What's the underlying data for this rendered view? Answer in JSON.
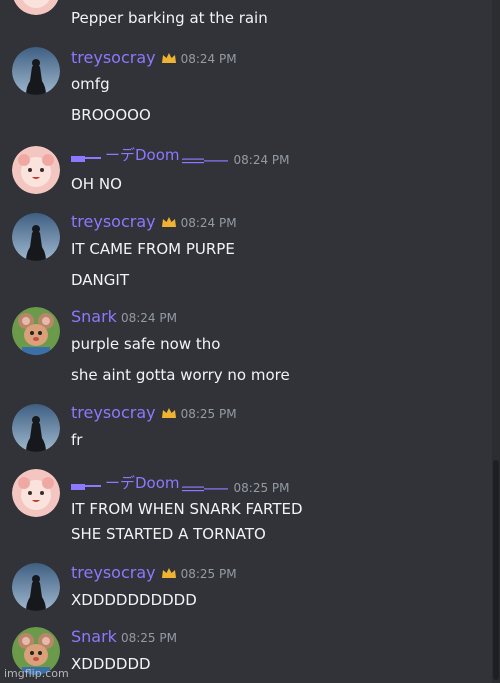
{
  "colors": {
    "background": "#313338",
    "text": "#f2f3f5",
    "timestamp": "#949ba4",
    "treysocray": "#8b79ff",
    "snark": "#8b79ff",
    "doom": "#8b79ff",
    "crown": "#f0b232"
  },
  "messages": [
    {
      "id": "m0",
      "author": "",
      "avatar": "pink-face-avatar",
      "lines": [
        "Pepper barking at the rain"
      ]
    },
    {
      "id": "m1",
      "author": "treysocray",
      "owner_crown": true,
      "avatar": "silhouette-avatar",
      "time": "08:24 PM",
      "lines": [
        "omfg",
        "BROOOOO"
      ]
    },
    {
      "id": "m2",
      "author": "ーデDoom",
      "owner_crown": false,
      "avatar": "pink-face-avatar",
      "time": "08:24 PM",
      "lines": [
        "OH NO"
      ]
    },
    {
      "id": "m3",
      "author": "treysocray",
      "owner_crown": true,
      "avatar": "silhouette-avatar",
      "time": "08:24 PM",
      "lines": [
        "IT CAME FROM PURPE",
        "DANGIT"
      ]
    },
    {
      "id": "m4",
      "author": "Snark",
      "owner_crown": false,
      "avatar": "mouse-avatar",
      "time": "08:24 PM",
      "lines": [
        "purple safe now tho",
        "she aint gotta worry no more"
      ]
    },
    {
      "id": "m5",
      "author": "treysocray",
      "owner_crown": true,
      "avatar": "silhouette-avatar",
      "time": "08:25 PM",
      "lines": [
        "fr"
      ]
    },
    {
      "id": "m6",
      "author": "ーデDoom",
      "owner_crown": false,
      "avatar": "pink-face-avatar",
      "time": "08:25 PM",
      "lines": [
        "IT FROM WHEN SNARK FARTED",
        "SHE STARTED A TORNATO"
      ]
    },
    {
      "id": "m7",
      "author": "treysocray",
      "owner_crown": true,
      "avatar": "silhouette-avatar",
      "time": "08:25 PM",
      "lines": [
        "XDDDDDDDDDD"
      ]
    },
    {
      "id": "m8",
      "author": "Snark",
      "owner_crown": false,
      "avatar": "mouse-avatar",
      "time": "08:25 PM",
      "lines": [
        "XDDDDDD"
      ]
    }
  ],
  "watermark": "imgflip.com"
}
